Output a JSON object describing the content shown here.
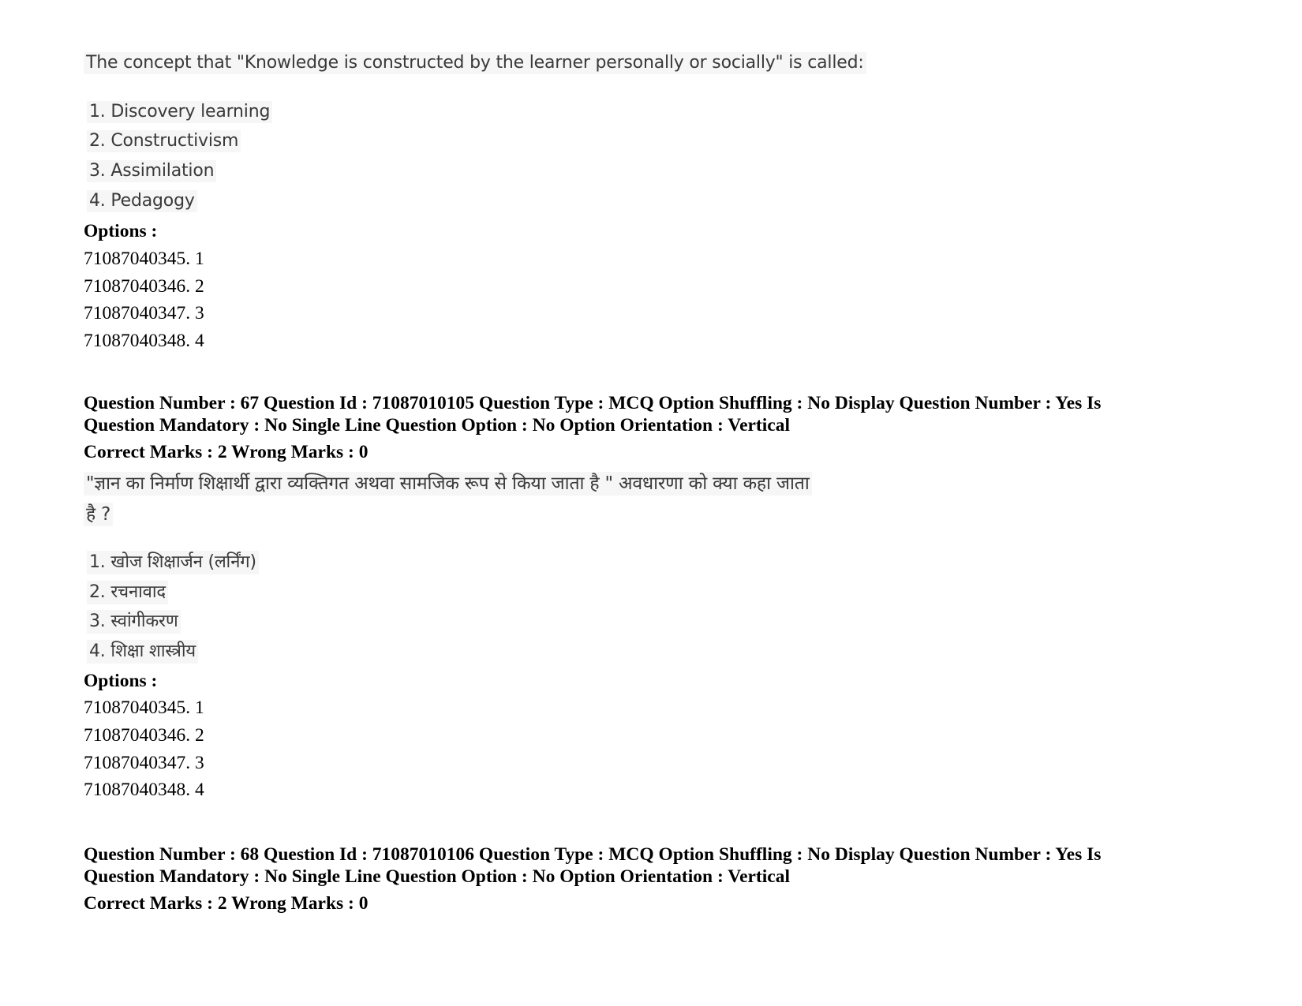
{
  "question_66_tail": {
    "question_text": "The concept that \"Knowledge is constructed by the learner personally or socially\" is called:",
    "choices": [
      "1. Discovery learning",
      "2. Constructivism",
      "3. Assimilation",
      "4. Pedagogy"
    ],
    "options_label": "Options :",
    "options": [
      "71087040345. 1",
      "71087040346. 2",
      "71087040347. 3",
      "71087040348. 4"
    ]
  },
  "question_67": {
    "header_line1": "Question Number : 67 Question Id : 71087010105 Question Type : MCQ Option Shuffling : No Display Question Number : Yes Is",
    "header_line2": "Question Mandatory : No Single Line Question Option : No Option Orientation : Vertical",
    "marks": "Correct Marks : 2 Wrong Marks : 0",
    "question_text_line1": "\"ज्ञान का निर्माण शिक्षार्थी द्वारा व्यक्तिगत अथवा सामजिक रूप से किया जाता है \" अवधारणा को क्या कहा जाता",
    "question_text_line2": "है ?",
    "choices": [
      "1. खोज शिक्षार्जन (लर्निंग)",
      "2. रचनावाद",
      "3. स्वांगीकरण",
      "4. शिक्षा शास्त्रीय"
    ],
    "options_label": "Options :",
    "options": [
      "71087040345. 1",
      "71087040346. 2",
      "71087040347. 3",
      "71087040348. 4"
    ]
  },
  "question_68": {
    "header_line1": "Question Number : 68 Question Id : 71087010106 Question Type : MCQ Option Shuffling : No Display Question Number : Yes Is",
    "header_line2": "Question Mandatory : No Single Line Question Option : No Option Orientation : Vertical",
    "marks": "Correct Marks : 2 Wrong Marks : 0"
  }
}
